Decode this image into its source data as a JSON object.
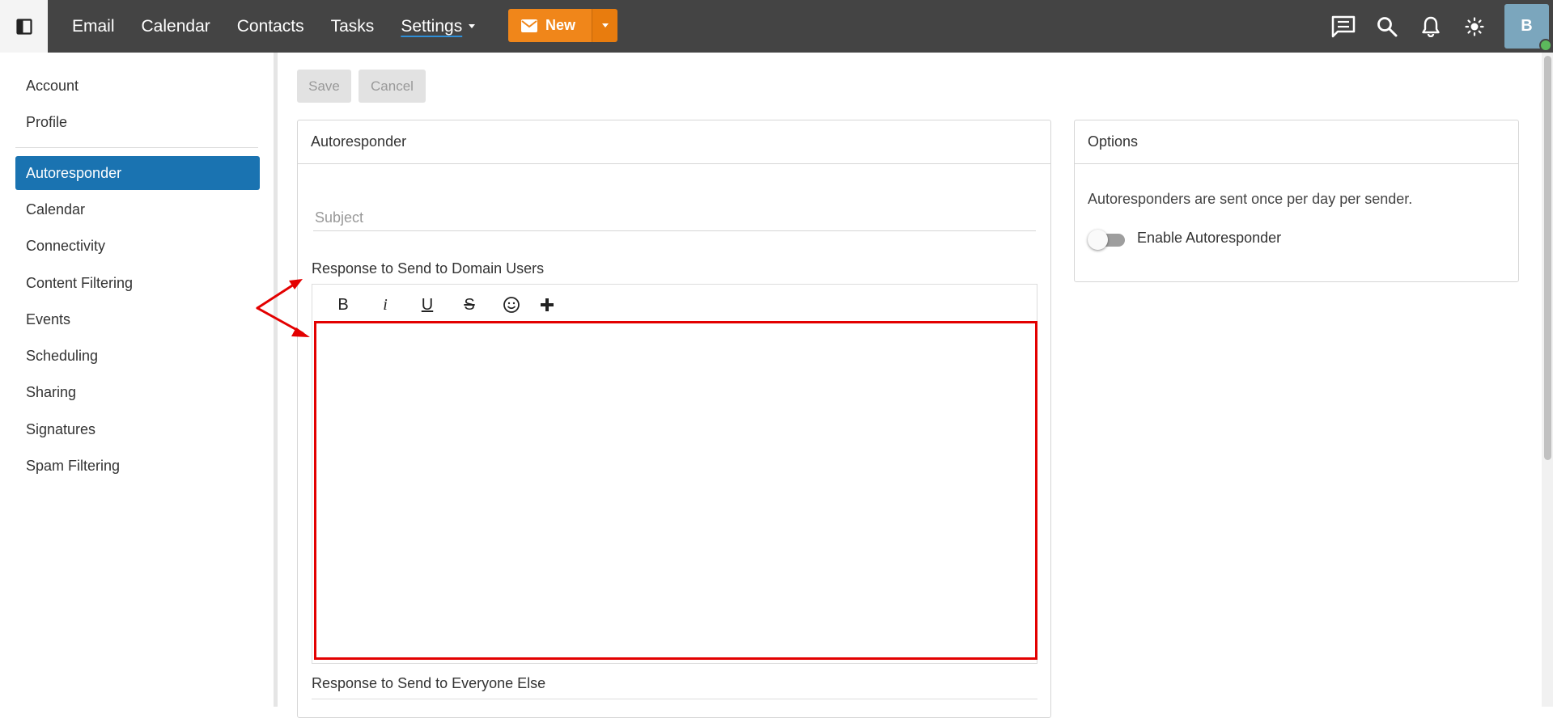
{
  "nav": {
    "items": [
      "Email",
      "Calendar",
      "Contacts",
      "Tasks"
    ],
    "active": "Settings",
    "new_label": "New"
  },
  "user": {
    "initial": "B"
  },
  "sidebar": {
    "top_items": [
      "Account",
      "Profile"
    ],
    "active": "Autoresponder",
    "items": [
      "Calendar",
      "Connectivity",
      "Content Filtering",
      "Events",
      "Scheduling",
      "Sharing",
      "Signatures",
      "Spam Filtering"
    ]
  },
  "actions": {
    "save": "Save",
    "cancel": "Cancel"
  },
  "autoresponder": {
    "title": "Autoresponder",
    "subject_placeholder": "Subject",
    "domain_label": "Response to Send to Domain Users",
    "everyone_label": "Response to Send to Everyone Else",
    "toolbar": [
      "B",
      "i",
      "U",
      "S"
    ]
  },
  "options": {
    "title": "Options",
    "note": "Autoresponders are sent once per day per sender.",
    "toggle_label": "Enable Autoresponder",
    "enabled": false
  },
  "colors": {
    "topbar": "#444444",
    "accent_orange": "#f0861a",
    "active_blue": "#1a73b1",
    "highlight_red": "#e30000"
  }
}
